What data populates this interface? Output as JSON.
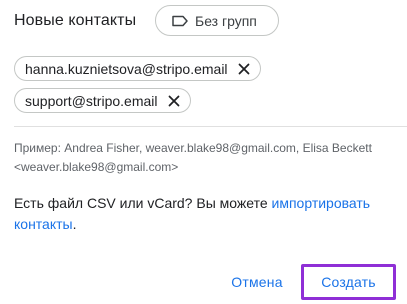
{
  "dialog": {
    "title": "Новые контакты",
    "group_button_label": "Без групп"
  },
  "recipients": [
    {
      "email": "hanna.kuznietsova@stripo.email"
    },
    {
      "email": "support@stripo.email"
    }
  ],
  "hint_text": "Пример: Andrea Fisher, weaver.blake98@gmail.com, Elisa Beckett <weaver.blake98@gmail.com>",
  "csv": {
    "text": "Есть файл CSV или vCard? Вы можете ",
    "link": "импортировать контакты",
    "suffix": "."
  },
  "actions": {
    "cancel_label": "Отмена",
    "create_label": "Создать"
  },
  "colors": {
    "accent": "#1a73e8",
    "highlight_border": "#8f2fd6"
  },
  "icons": {
    "group": "label-icon",
    "remove": "close-icon"
  }
}
